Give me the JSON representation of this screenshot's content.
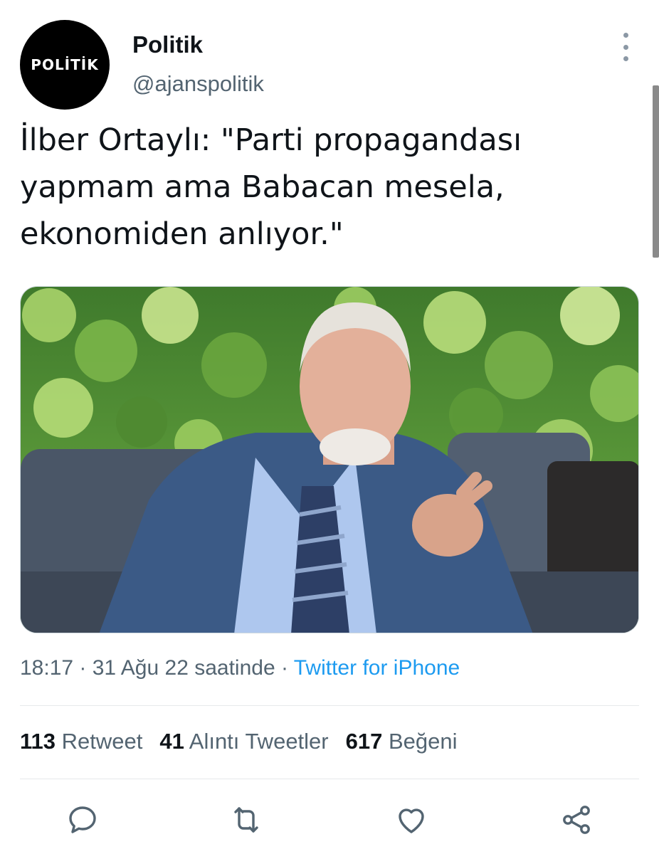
{
  "author": {
    "avatar_text": "POLİTİK",
    "display_name": "Politik",
    "handle": "@ajanspolitik"
  },
  "tweet": {
    "lines": [
      "İlber Ortaylı: \"Parti propagandası",
      "yapmam ama Babacan mesela,",
      "ekonomiden anlıyor.\""
    ]
  },
  "meta": {
    "time": "18:17",
    "sep1": " · ",
    "date": "31 Ağu 22 saatinde",
    "sep2": " · ",
    "source": "Twitter for iPhone"
  },
  "stats": {
    "retweets_count": "113",
    "retweets_label": "Retweet",
    "quotes_count": "41",
    "quotes_label": "Alıntı Tweetler",
    "likes_count": "617",
    "likes_label": "Beğeni"
  },
  "actions": {
    "reply_icon": "reply-icon",
    "retweet_icon": "retweet-icon",
    "like_icon": "heart-icon",
    "share_icon": "share-icon"
  },
  "colors": {
    "text": "#0f1419",
    "secondary": "#536471",
    "link": "#1d9bf0",
    "divider": "#e6e9eb"
  }
}
